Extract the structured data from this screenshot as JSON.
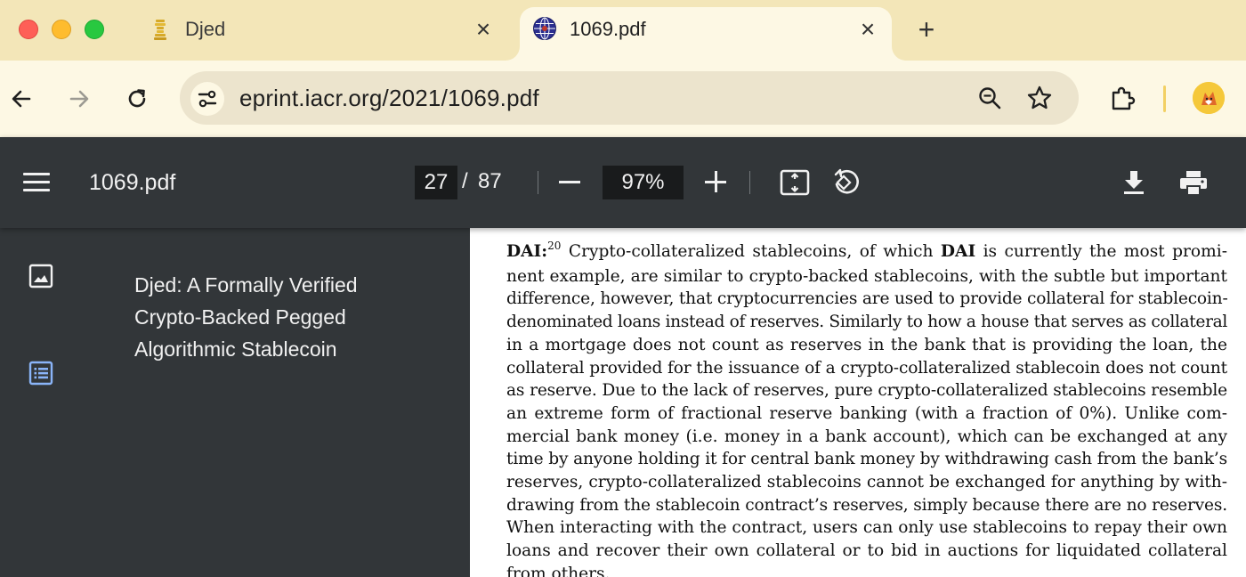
{
  "browser": {
    "tabs": [
      {
        "title": "Djed",
        "favicon": "coin-stack-icon",
        "active": false,
        "close_label": "×"
      },
      {
        "title": "1069.pdf",
        "favicon": "globe-icon",
        "active": true,
        "close_label": "×"
      }
    ],
    "new_tab_label": "+",
    "url": "eprint.iacr.org/2021/1069.pdf"
  },
  "pdf_viewer": {
    "filename": "1069.pdf",
    "current_page": "27",
    "page_separator": "/",
    "total_pages": "87",
    "zoom": "97%",
    "outline": {
      "items": [
        "Djed: A Formally Verified Crypto-Backed Pegged Algorithmic Stablecoin"
      ]
    }
  },
  "document": {
    "heading": "DAI:",
    "footnote_ref": "20",
    "lines": [
      "Crypto-collateralized stablecoins, of which",
      "DAI",
      "is currently the most promi-",
      "nent example, are similar to crypto-backed stablecoins, with the subtle but important",
      "difference, however, that cryptocurrencies are used to provide collateral for stablecoin-",
      "denominated loans instead of reserves. Similarly to how a house that serves as collateral",
      "in a mortgage does not count as reserves in the bank that is providing the loan, the",
      "collateral provided for the issuance of a crypto-collateralized stablecoin does not count",
      "as reserve. Due to the lack of reserves, pure crypto-collateralized stablecoins resemble",
      "an extreme form of fractional reserve banking (with a fraction of 0%). Unlike com-",
      "mercial bank money (i.e. money in a bank account), which can be exchanged at any",
      "time by anyone holding it for central bank money by withdrawing cash from the bank’s",
      "reserves, crypto-collateralized stablecoins cannot be exchanged for anything by with-",
      "drawing from the stablecoin contract’s reserves, simply because there are no reserves.",
      "When interacting with the contract, users can only use stablecoins to repay their own",
      "loans and recover their own collateral or to bid in auctions for liquidated collateral",
      "from others."
    ]
  },
  "colors": {
    "tabstrip_bg": "#f3e6b8",
    "toolbar_bg": "#fdf8e4",
    "pdf_chrome_bg": "#323639",
    "outline_icon_accent": "#8ab4f8"
  }
}
